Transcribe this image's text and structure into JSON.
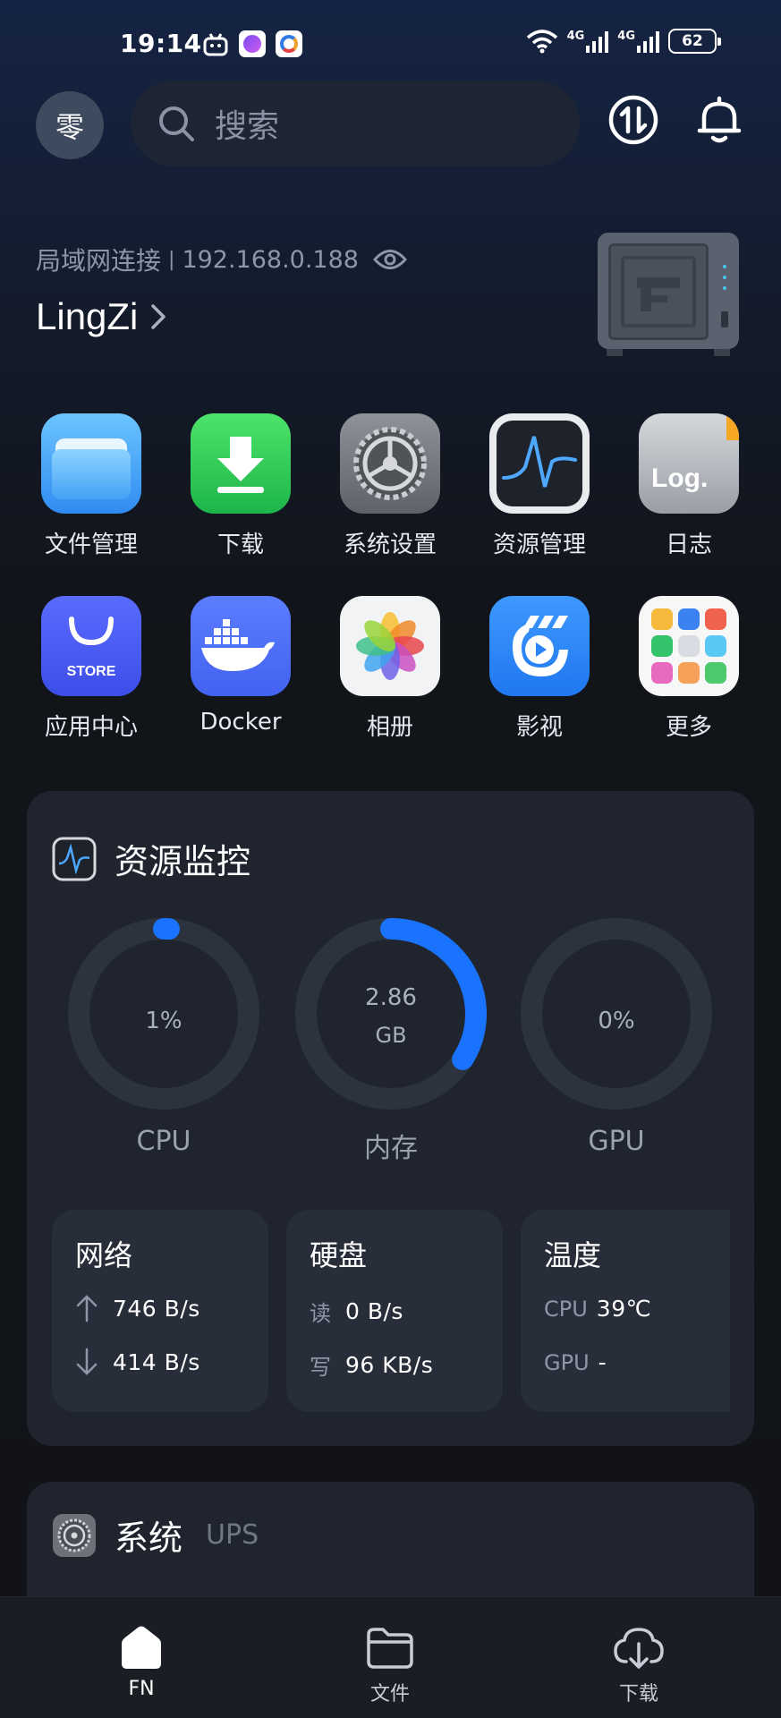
{
  "status_bar": {
    "time": "19:14",
    "network_1": "4G",
    "network_2": "4G",
    "battery": "62"
  },
  "header": {
    "avatar_char": "零",
    "search_placeholder": "搜索"
  },
  "connection": {
    "label": "局域网连接",
    "separator": "|",
    "ip": "192.168.0.188",
    "device_name": "LingZi"
  },
  "apps": [
    {
      "label": "文件管理",
      "icon": "folder-icon"
    },
    {
      "label": "下载",
      "icon": "download-icon"
    },
    {
      "label": "系统设置",
      "icon": "settings-gear-icon"
    },
    {
      "label": "资源管理",
      "icon": "activity-monitor-icon"
    },
    {
      "label": "日志",
      "icon": "log-icon",
      "icon_text": "Log."
    },
    {
      "label": "应用中心",
      "icon": "store-icon",
      "icon_text": "STORE"
    },
    {
      "label": "Docker",
      "icon": "docker-icon"
    },
    {
      "label": "相册",
      "icon": "photos-icon"
    },
    {
      "label": "影视",
      "icon": "video-icon"
    },
    {
      "label": "更多",
      "icon": "more-apps-icon"
    }
  ],
  "monitor": {
    "title": "资源监控",
    "gauges": [
      {
        "label": "CPU",
        "value": "1%",
        "fraction": 0.01
      },
      {
        "label": "内存",
        "value_line1": "2.86",
        "value_line2": "GB",
        "fraction": 0.34
      },
      {
        "label": "GPU",
        "value": "0%",
        "fraction": 0.0
      }
    ],
    "network": {
      "title": "网络",
      "up": "746 B/s",
      "down": "414 B/s"
    },
    "disk": {
      "title": "硬盘",
      "read_label": "读",
      "read": "0 B/s",
      "write_label": "写",
      "write": "96 KB/s"
    },
    "temperature": {
      "title": "温度",
      "cpu_label": "CPU",
      "cpu": "39℃",
      "gpu_label": "GPU",
      "gpu": "-"
    }
  },
  "system_card": {
    "title": "系统",
    "subtitle": "UPS"
  },
  "bottom_nav": [
    {
      "label": "FN",
      "icon": "home-icon",
      "active": true
    },
    {
      "label": "文件",
      "icon": "folder-outline-icon",
      "active": false
    },
    {
      "label": "下载",
      "icon": "download-cloud-icon",
      "active": false
    }
  ],
  "colors": {
    "accent": "#1a73ff",
    "card_bg": "#1f242e"
  }
}
